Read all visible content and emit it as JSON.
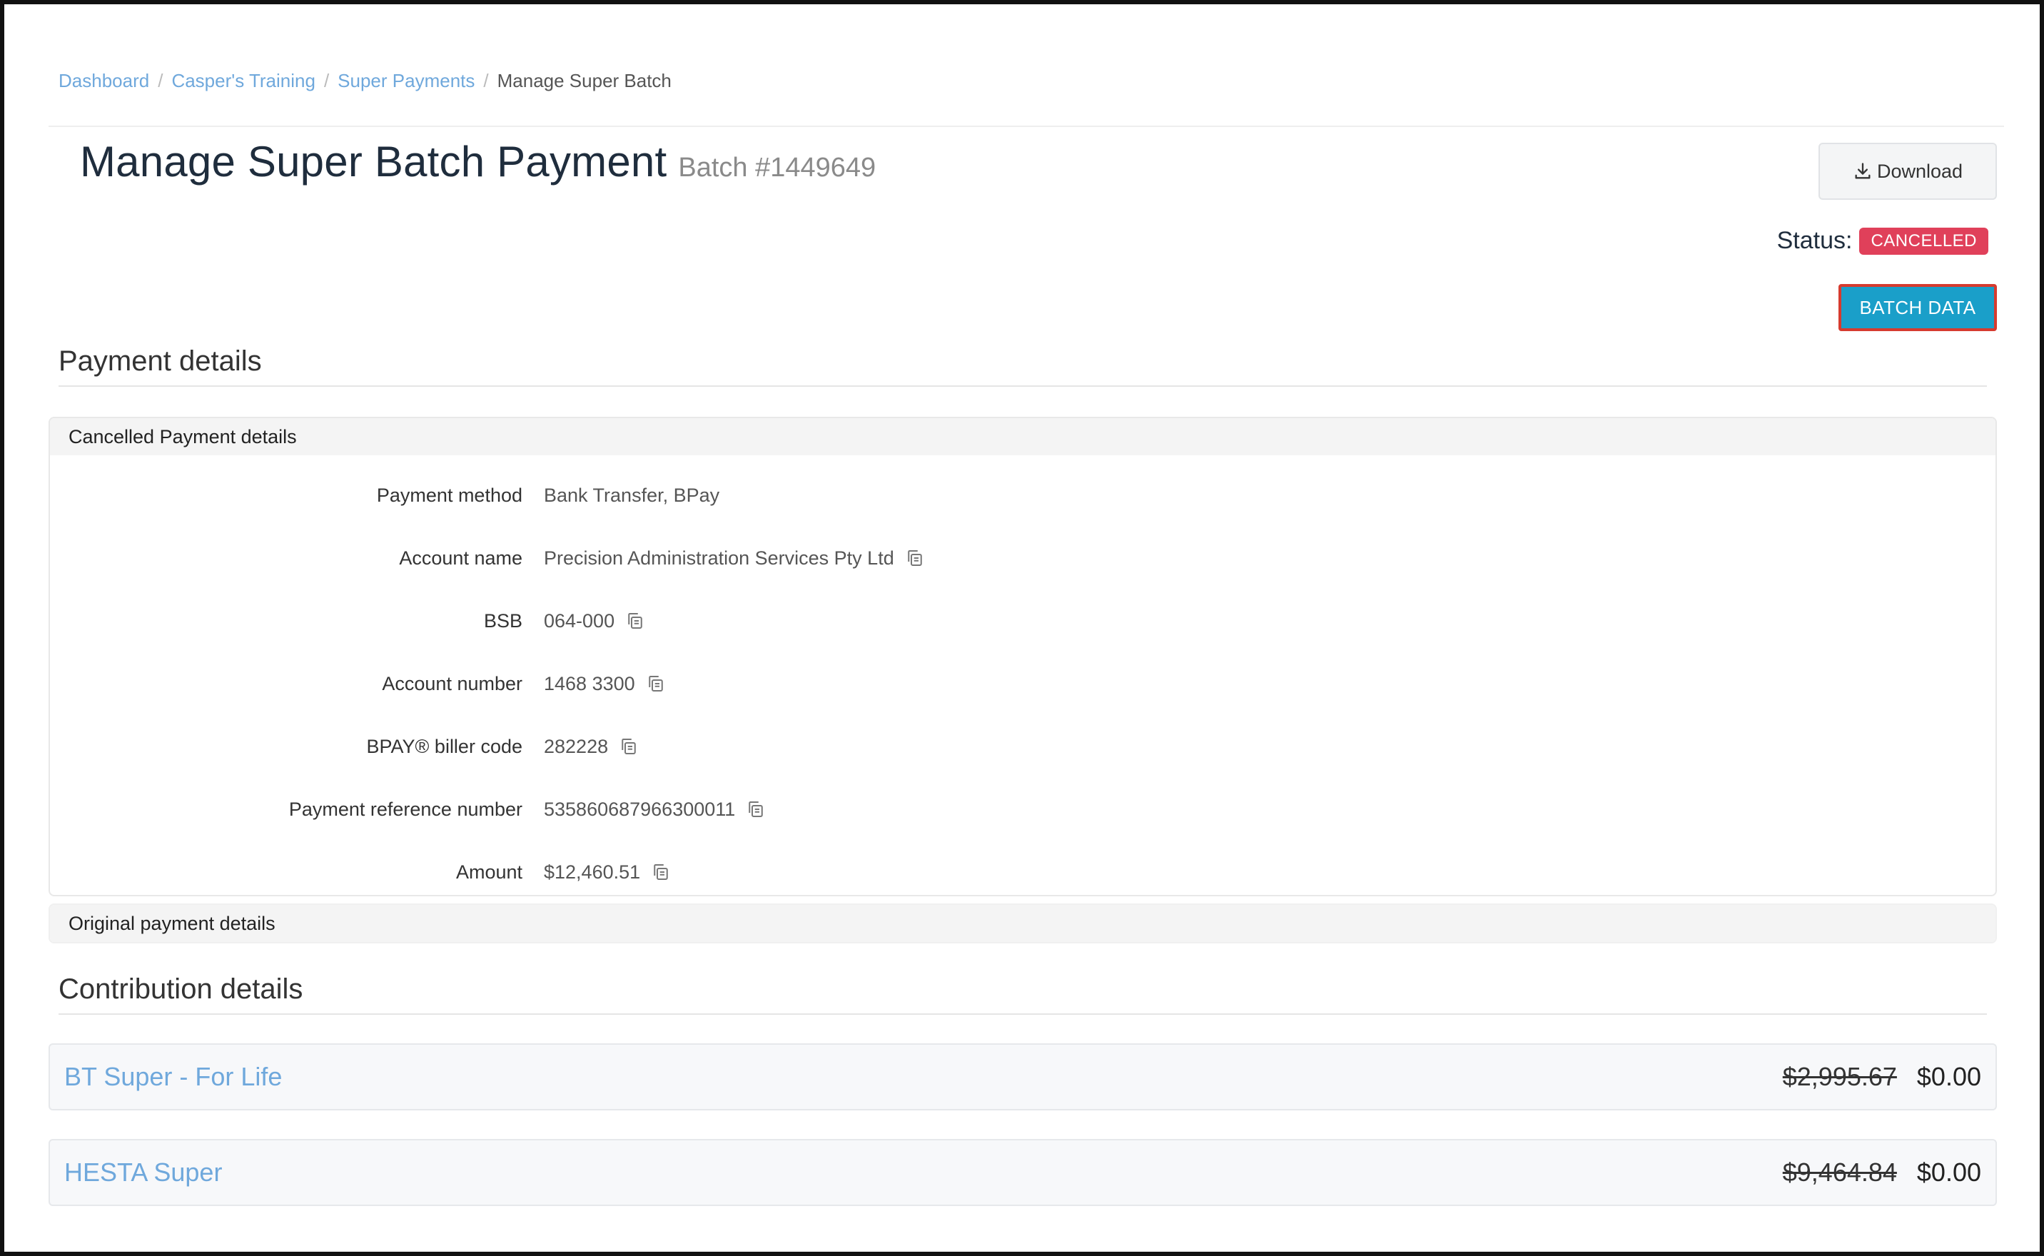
{
  "breadcrumb": {
    "items": [
      "Dashboard",
      "Casper's Training",
      "Super Payments"
    ],
    "current": "Manage Super Batch",
    "separator": "/"
  },
  "header": {
    "title": "Manage Super Batch Payment",
    "batch": "Batch #1449649",
    "download_label": "Download",
    "download_icon": "download-icon"
  },
  "status": {
    "label": "Status:",
    "value": "CANCELLED",
    "color": "#e0405a"
  },
  "batch_data_button": {
    "label": "BATCH DATA",
    "color": "#1a9fc9",
    "highlight_border": "#d63b2f"
  },
  "payment_section": {
    "heading": "Payment details",
    "cancelled_panel_title": "Cancelled Payment details",
    "rows": [
      {
        "label": "Payment method",
        "value": "Bank Transfer, BPay",
        "copyable": false
      },
      {
        "label": "Account name",
        "value": "Precision Administration Services Pty Ltd",
        "copyable": true
      },
      {
        "label": "BSB",
        "value": "064-000",
        "copyable": true
      },
      {
        "label": "Account number",
        "value": "1468 3300",
        "copyable": true
      },
      {
        "label": "BPAY® biller code",
        "value": "282228",
        "copyable": true
      },
      {
        "label": "Payment reference number",
        "value": "535860687966300011",
        "copyable": true
      },
      {
        "label": "Amount",
        "value": "$12,460.51",
        "copyable": true
      }
    ],
    "original_panel_title": "Original payment details"
  },
  "contribution_section": {
    "heading": "Contribution details",
    "funds": [
      {
        "name": "BT Super - For Life",
        "original_amount": "$2,995.67",
        "current_amount": "$0.00"
      },
      {
        "name": "HESTA Super",
        "original_amount": "$9,464.84",
        "current_amount": "$0.00"
      }
    ]
  },
  "colors": {
    "link": "#6fa8dc",
    "title": "#1f2d3d"
  }
}
